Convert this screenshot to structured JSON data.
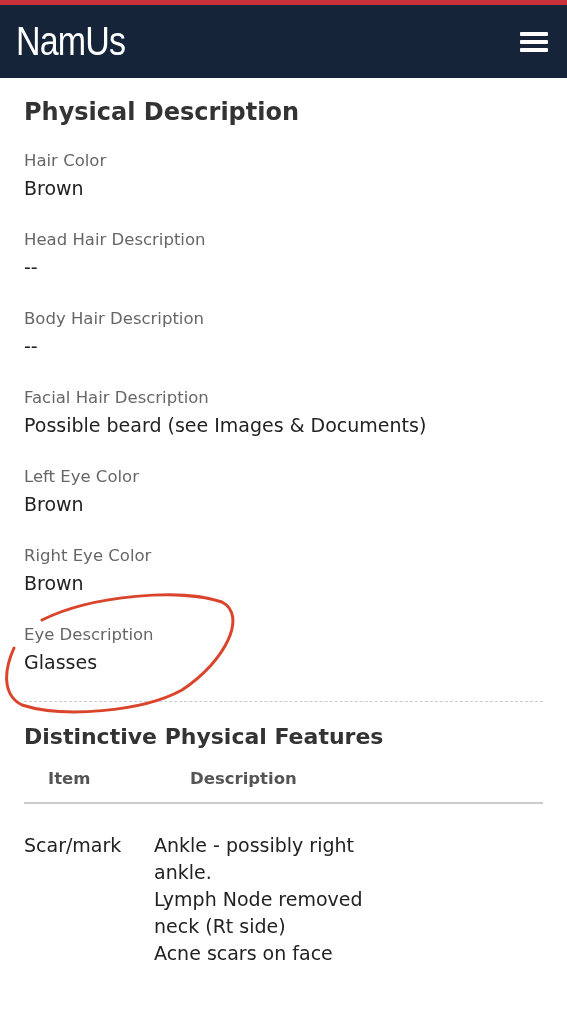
{
  "header": {
    "logo": "NamUs"
  },
  "physical_description": {
    "title": "Physical Description",
    "fields": [
      {
        "label": "Hair Color",
        "value": "Brown",
        "circled": false
      },
      {
        "label": "Head Hair Description",
        "value": "--",
        "circled": false
      },
      {
        "label": "Body Hair Description",
        "value": "--",
        "circled": false
      },
      {
        "label": "Facial Hair Description",
        "value": "Possible beard (see Images & Documents)",
        "circled": false
      },
      {
        "label": "Left Eye Color",
        "value": "Brown",
        "circled": false
      },
      {
        "label": "Right Eye Color",
        "value": "Brown",
        "circled": false
      },
      {
        "label": "Eye Description",
        "value": "Glasses",
        "circled": true
      }
    ]
  },
  "distinctive_features": {
    "title": "Distinctive Physical Features",
    "columns": [
      "Item",
      "Description"
    ],
    "rows": [
      {
        "item": "Scar/mark",
        "description": [
          "Ankle - possibly right ankle.",
          "Lymph Node removed neck (Rt side)",
          "Acne scars on face"
        ]
      }
    ]
  }
}
